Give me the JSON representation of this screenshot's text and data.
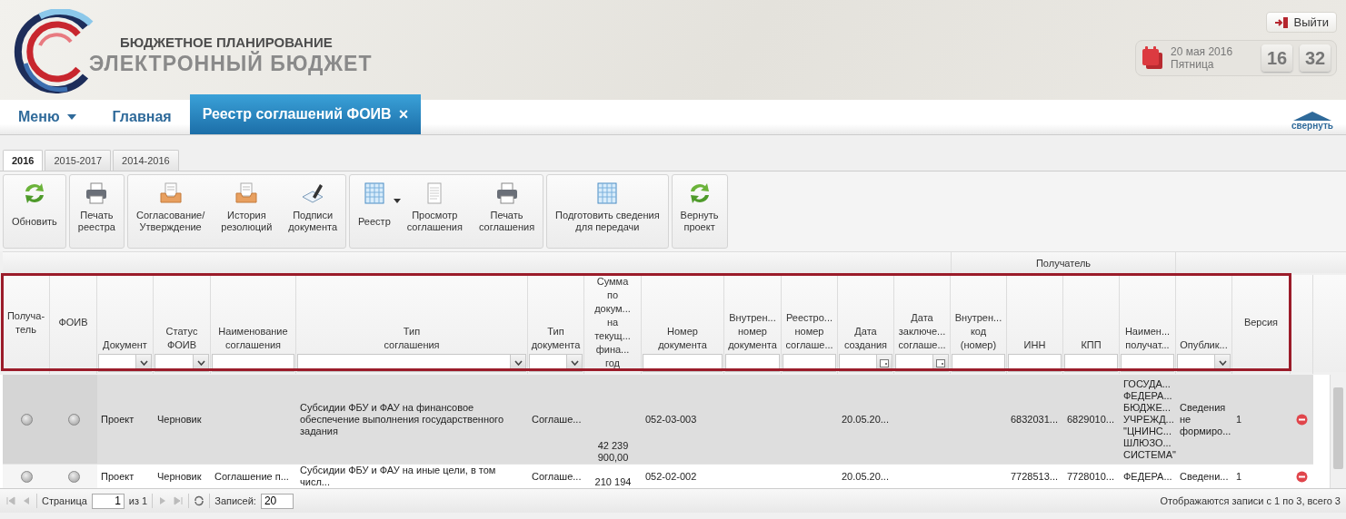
{
  "header": {
    "subtitle": "БЮДЖЕТНОЕ ПЛАНИРОВАНИЕ",
    "title": "ЭЛЕКТРОННЫЙ БЮДЖЕТ",
    "logout": "Выйти",
    "date": "20 мая 2016",
    "weekday": "Пятница",
    "hours": "16",
    "minutes": "32"
  },
  "nav": {
    "items": [
      {
        "label": "Меню",
        "kind": "menu",
        "selected": false
      },
      {
        "label": "Главная",
        "kind": "link",
        "selected": false
      },
      {
        "label": "Реестр соглашений ФОИВ",
        "kind": "tab",
        "selected": true,
        "close": "×"
      }
    ],
    "collapse": "свернуть"
  },
  "year_tabs": [
    {
      "label": "2016",
      "selected": true
    },
    {
      "label": "2015-2017",
      "selected": false
    },
    {
      "label": "2014-2016",
      "selected": false
    }
  ],
  "toolbar": [
    {
      "buttons": [
        {
          "label": "Обновить",
          "kind": "refresh"
        }
      ]
    },
    {
      "buttons": [
        {
          "label": "Печать\nреестра",
          "kind": "print"
        }
      ]
    },
    {
      "buttons": [
        {
          "label": "Согласование/\nУтверждение",
          "kind": "tray"
        },
        {
          "label": "История\nрезолюций",
          "kind": "tray"
        },
        {
          "label": "Подписи\nдокумента",
          "kind": "sign"
        }
      ]
    },
    {
      "buttons": [
        {
          "label": "Реестр",
          "kind": "grid",
          "dropdown": true
        },
        {
          "label": "Просмотр\nсоглашения",
          "kind": "page"
        },
        {
          "label": "Печать\nсоглашения",
          "kind": "print"
        }
      ]
    },
    {
      "buttons": [
        {
          "label": "Подготовить сведения\nдля передачи",
          "kind": "grid"
        }
      ]
    },
    {
      "buttons": [
        {
          "label": "Вернуть\nпроект",
          "kind": "refresh"
        }
      ]
    }
  ],
  "table": {
    "group_header": "Получатель",
    "columns": [
      {
        "label": "Получа-\nтель",
        "kind": "dot"
      },
      {
        "label": "ФОИВ",
        "kind": "dot"
      },
      {
        "label": "Документ",
        "kind": "select"
      },
      {
        "label": "Статус\nФОИВ",
        "kind": "select"
      },
      {
        "label": "Наименование\nсоглашения",
        "kind": "text"
      },
      {
        "label": "Тип\nсоглашения",
        "kind": "select"
      },
      {
        "label": "Тип\nдокумента",
        "kind": "select"
      },
      {
        "label": "Сумма\nпо\nдокум...\nна\nтекущ...\nфина...\nгод",
        "kind": "amount"
      },
      {
        "label": "Номер\nдокумента",
        "kind": "text"
      },
      {
        "label": "Внутрен...\nномер\nдокумента",
        "kind": "text"
      },
      {
        "label": "Реестро...\nномер\nсоглаше...",
        "kind": "text"
      },
      {
        "label": "Дата\nсоздания",
        "kind": "date"
      },
      {
        "label": "Дата\nзаключе...\nсоглаше...",
        "kind": "date"
      },
      {
        "label": "Внутрен...\nкод\n(номер)",
        "kind": "text"
      },
      {
        "label": "ИНН",
        "kind": "text"
      },
      {
        "label": "КПП",
        "kind": "text"
      },
      {
        "label": "Наимен...\nполучат...",
        "kind": "text"
      },
      {
        "label": "Опублик...",
        "kind": "select"
      },
      {
        "label": "Версия",
        "kind": "plain"
      }
    ],
    "rows": [
      {
        "selected": true,
        "cells": [
          null,
          null,
          "Проект",
          "Черновик",
          null,
          "Субсидии ФБУ и ФАУ на финансовое обеспечение выполнения государственного задания",
          "Соглаше...",
          "42 239\n900,00",
          "052-03-003",
          null,
          null,
          "20.05.20...",
          null,
          null,
          "6832031...",
          "6829010...",
          "ГОСУДА...\nФЕДЕРА...\nБЮДЖЕ...\nУЧРЕЖД...\n\"ЦНИНС...\nШЛЮЗО...\nСИСТЕМА\"",
          "Сведения\nне\nформиро...",
          "1"
        ]
      },
      {
        "selected": false,
        "cells": [
          null,
          null,
          "Проект",
          "Черновик",
          "Соглашение п...",
          "Субсидии ФБУ и ФАУ на иные цели, в том числ...",
          "Соглаше...",
          "210 194",
          "052-02-002",
          null,
          null,
          "20.05.20...",
          null,
          null,
          "7728513...",
          "7728010...",
          "ФЕДЕРА...",
          "Сведени...",
          "1"
        ]
      }
    ]
  },
  "pager": {
    "page_label": "Страница",
    "page": "1",
    "of": "из 1",
    "records_label": "Записей:",
    "records": "20",
    "summary": "Отображаются записи с 1 по 3, всего 3"
  }
}
